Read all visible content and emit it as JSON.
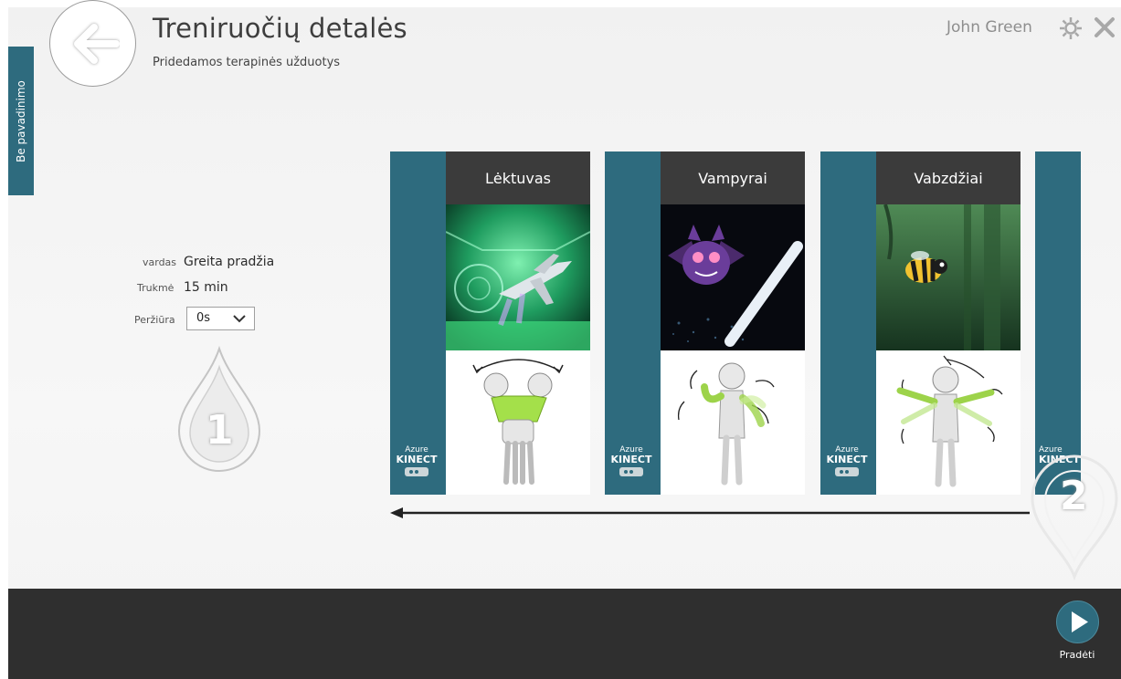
{
  "sidebar": {
    "tab_label": "Be pavadinimo"
  },
  "header": {
    "title": "Treniruočių detalės",
    "subtitle": "Pridedamos terapinės užduotys",
    "user_name": "John Green"
  },
  "details": {
    "name_label": "vardas",
    "name_value": "Greita pradžia",
    "duration_label": "Trukmė",
    "duration_value": "15 min",
    "preview_label": "Peržiūra",
    "preview_value": "0s"
  },
  "markers": {
    "first": "1",
    "second": "2"
  },
  "cards": [
    {
      "title": "Lėktuvas",
      "sensor_top": "Azure",
      "sensor_bottom": "KINECT"
    },
    {
      "title": "Vampyrai",
      "sensor_top": "Azure",
      "sensor_bottom": "KINECT"
    },
    {
      "title": "Vabzdžiai",
      "sensor_top": "Azure",
      "sensor_bottom": "KINECT"
    },
    {
      "title": "",
      "sensor_top": "Azure",
      "sensor_bottom": "KINECT"
    }
  ],
  "footer": {
    "start_label": "Pradėti"
  },
  "colors": {
    "accent": "#2e6b7e",
    "bottom_bar": "#2f2f2f",
    "card_title_bg": "#3b3b3b"
  },
  "icons": {
    "back": "arrow-left-icon",
    "settings": "gear-icon",
    "close": "close-icon",
    "play": "play-icon",
    "dropdown": "chevron-down-icon"
  }
}
